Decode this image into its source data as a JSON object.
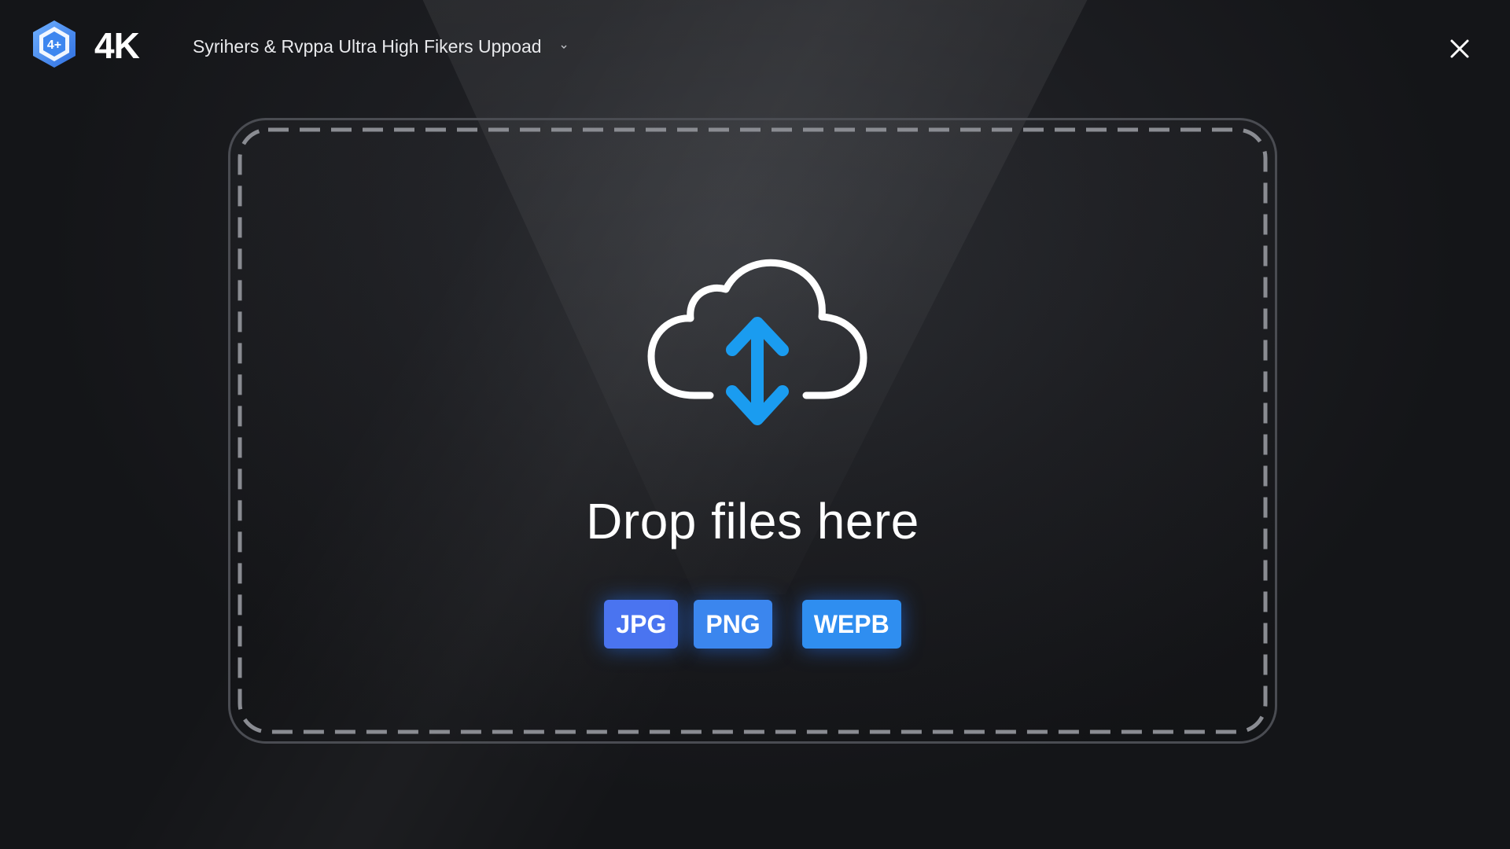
{
  "header": {
    "brand": "4K",
    "title": "Syrihers  & Rvppa Ultra High Fikers Uppoad",
    "title_chevron_icon": "chevron-down-icon",
    "logo_icon": "hexagon-logo-icon",
    "close_icon": "close-icon"
  },
  "drop_zone": {
    "icon": "cloud-upload-download-icon",
    "label": "Drop files here",
    "formats": [
      "JPG",
      "PNG",
      "WEPB"
    ]
  },
  "colors": {
    "background": "#16171a",
    "accent_blue": "#1a9cf0",
    "badge_jpg": "#4a74f0",
    "badge_png": "#3b86ee",
    "badge_wepb": "#2f8ef0",
    "border": "#4a4c52",
    "dash": "#8a8c92"
  }
}
